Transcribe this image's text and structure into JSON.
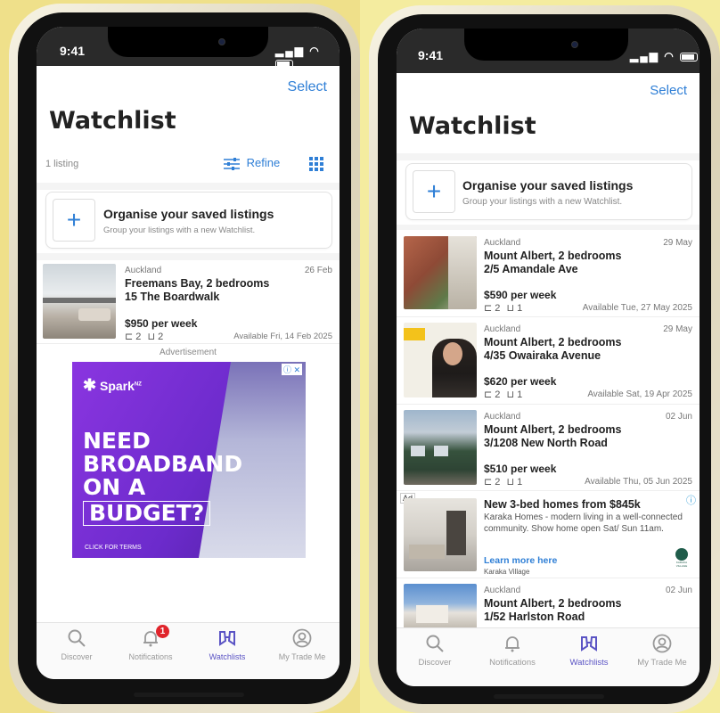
{
  "colors": {
    "accent": "#2f7fd6",
    "active_tab": "#5a53c4",
    "ad_purple": "#7b2fd0",
    "badge_red": "#e0242b"
  },
  "left": {
    "status_time": "9:41",
    "select_label": "Select",
    "title": "Watchlist",
    "count": "1 listing",
    "refine_label": "Refine",
    "organise": {
      "title": "Organise your saved listings",
      "subtitle": "Group your listings with a new Watchlist."
    },
    "listing": {
      "region": "Auckland",
      "date": "26 Feb",
      "title_line1": "Freemans Bay, 2 bedrooms",
      "title_line2": "15 The Boardwalk",
      "price": "$950 per week",
      "beds": "2",
      "baths": "2",
      "available": "Available Fri, 14 Feb 2025"
    },
    "ad_label": "Advertisement",
    "ad": {
      "brand": "Spark",
      "brand_tm": "NZ",
      "headline1": "NEED",
      "headline2": "BROADBAND",
      "headline3": "ON A",
      "headline4": "BUDGET?",
      "terms": "CLICK FOR TERMS"
    },
    "tabs": [
      {
        "label": "Discover",
        "icon": "search-icon"
      },
      {
        "label": "Notifications",
        "icon": "bell-icon",
        "badge": "1"
      },
      {
        "label": "Watchlists",
        "icon": "binoculars-icon"
      },
      {
        "label": "My Trade Me",
        "icon": "user-icon"
      }
    ]
  },
  "right": {
    "status_time": "9:41",
    "select_label": "Select",
    "title": "Watchlist",
    "organise": {
      "title": "Organise your saved listings",
      "subtitle": "Group your listings with a new Watchlist."
    },
    "listings": [
      {
        "region": "Auckland",
        "date": "29 May",
        "title_line1": "Mount Albert, 2 bedrooms",
        "title_line2": "2/5 Amandale Ave",
        "price": "$590 per week",
        "beds": "2",
        "baths": "1",
        "available": "Available Tue, 27 May 2025"
      },
      {
        "region": "Auckland",
        "date": "29 May",
        "title_line1": "Mount Albert, 2 bedrooms",
        "title_line2": "4/35 Owairaka Avenue",
        "price": "$620 per week",
        "beds": "2",
        "baths": "1",
        "available": "Available Sat, 19 Apr 2025"
      },
      {
        "region": "Auckland",
        "date": "02 Jun",
        "title_line1": "Mount Albert, 2 bedrooms",
        "title_line2": "3/1208 New North Road",
        "price": "$510 per week",
        "beds": "2",
        "baths": "1",
        "available": "Available Thu, 05 Jun 2025"
      }
    ],
    "ad": {
      "tag": "Ad",
      "title": "New 3-bed homes from $845k",
      "body": "Karaka Homes - modern living in a well-connected community. Show home open Sat/ Sun 11am.",
      "link": "Learn more here",
      "sponsor": "Karaka Village",
      "logo_text": "KARAKA VILLAGE"
    },
    "last_listing": {
      "region": "Auckland",
      "date": "02 Jun",
      "title_line1": "Mount Albert, 2 bedrooms",
      "title_line2": "1/52 Harlston Road"
    },
    "tabs": [
      {
        "label": "Discover",
        "icon": "search-icon"
      },
      {
        "label": "Notifications",
        "icon": "bell-icon"
      },
      {
        "label": "Watchlists",
        "icon": "binoculars-icon"
      },
      {
        "label": "My Trade Me",
        "icon": "user-icon"
      }
    ]
  }
}
